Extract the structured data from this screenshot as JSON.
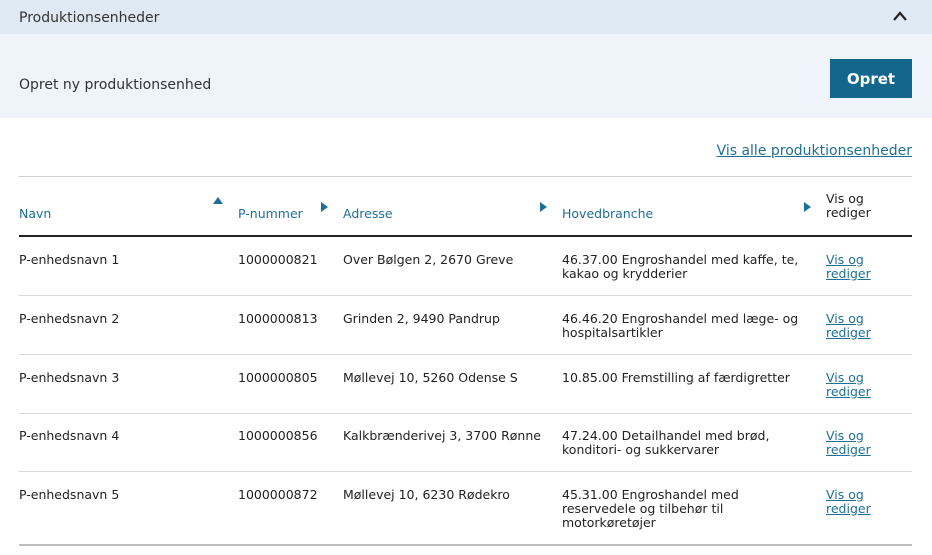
{
  "panel": {
    "title": "Produktionsenheder"
  },
  "create": {
    "label": "Opret ny produktionsenhed",
    "button_label": "Opret"
  },
  "links": {
    "show_all": "Vis alle produktionsenheder"
  },
  "table": {
    "headers": {
      "name": "Navn",
      "pnumber": "P-nummer",
      "address": "Adresse",
      "branch": "Hovedbranche",
      "edit": "Vis og rediger"
    },
    "rows": [
      {
        "name": "P-enhedsnavn 1",
        "pnumber": "1000000821",
        "address": "Over Bølgen 2, 2670 Greve",
        "branch": "46.37.00 Engroshandel med kaffe, te, kakao og krydderier",
        "edit": "Vis og rediger"
      },
      {
        "name": "P-enhedsnavn  2",
        "pnumber": "1000000813",
        "address": "Grinden 2, 9490 Pandrup",
        "branch": "46.46.20 Engroshandel med læge- og hospitalsartikler",
        "edit": "Vis og rediger"
      },
      {
        "name": "P-enhedsnavn  3",
        "pnumber": "1000000805",
        "address": "Møllevej 10, 5260 Odense S",
        "branch": "10.85.00 Fremstilling af færdigretter",
        "edit": "Vis og rediger"
      },
      {
        "name": "P-enhedsnavn  4",
        "pnumber": "1000000856",
        "address": "Kalkbrænderivej 3, 3700 Rønne",
        "branch": "47.24.00 Detailhandel med brød, konditori- og sukkervarer",
        "edit": "Vis og rediger"
      },
      {
        "name": "P-enhedsnavn  5",
        "pnumber": "1000000872",
        "address": "Møllevej 10, 6230 Rødekro",
        "branch": "45.31.00 Engroshandel med reservedele og tilbehør til motorkøretøjer",
        "edit": "Vis og rediger"
      }
    ]
  },
  "colors": {
    "accent": "#14668c",
    "link": "#1e6f98",
    "header_bg": "#dfe9f3",
    "band_bg": "#eef4fa"
  },
  "icons": {
    "collapse": "chevron-up-icon",
    "sort_asc": "sort-up-icon",
    "sort": "sort-right-icon"
  }
}
